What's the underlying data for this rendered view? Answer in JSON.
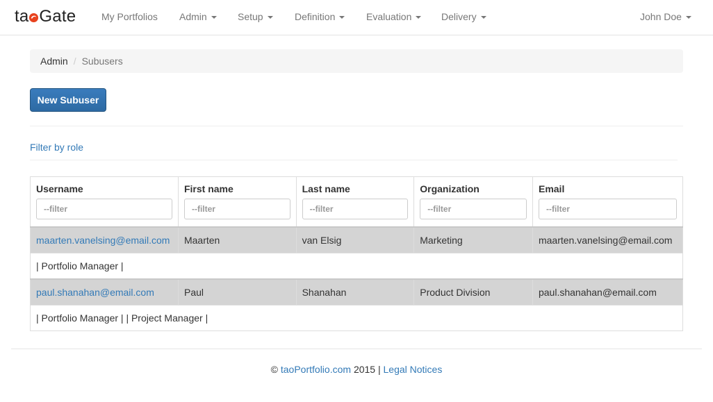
{
  "brand": {
    "text_pre": "ta",
    "text_post": "Gate",
    "logo_icon": "swirl-icon",
    "accent": "#e8421e"
  },
  "nav": {
    "items": [
      {
        "label": "My Portfolios",
        "dropdown": false
      },
      {
        "label": "Admin",
        "dropdown": true
      },
      {
        "label": "Setup",
        "dropdown": true
      },
      {
        "label": "Definition",
        "dropdown": true
      },
      {
        "label": "Evaluation",
        "dropdown": true
      },
      {
        "label": "Delivery",
        "dropdown": true
      }
    ],
    "user": {
      "label": "John Doe",
      "dropdown": true
    }
  },
  "breadcrumb": {
    "parent": "Admin",
    "separator": "/",
    "current": "Subusers"
  },
  "actions": {
    "new_subuser": "New Subuser"
  },
  "filter_by_role": "Filter by role",
  "table": {
    "columns": [
      {
        "label": "Username",
        "placeholder": "--filter"
      },
      {
        "label": "First name",
        "placeholder": "--filter"
      },
      {
        "label": "Last name",
        "placeholder": "--filter"
      },
      {
        "label": "Organization",
        "placeholder": "--filter"
      },
      {
        "label": "Email",
        "placeholder": "--filter"
      }
    ],
    "rows": [
      {
        "username": "maarten.vanelsing@email.com",
        "first_name": "Maarten",
        "last_name": "van Elsig",
        "organization": "Marketing",
        "email": "maarten.vanelsing@email.com",
        "roles": "| Portfolio Manager |"
      },
      {
        "username": "paul.shanahan@email.com",
        "first_name": "Paul",
        "last_name": "Shanahan",
        "organization": "Product Division",
        "email": "paul.shanahan@email.com",
        "roles": "| Portfolio Manager | | Project Manager |"
      }
    ]
  },
  "footer": {
    "copyright": "©",
    "site_link": "taoPortfolio.com",
    "year_sep": "2015 |",
    "legal_link": "Legal Notices"
  },
  "colors": {
    "link": "#337ab7",
    "primary_button": "#2d6aa3",
    "row_highlight": "#d4d4d4"
  }
}
